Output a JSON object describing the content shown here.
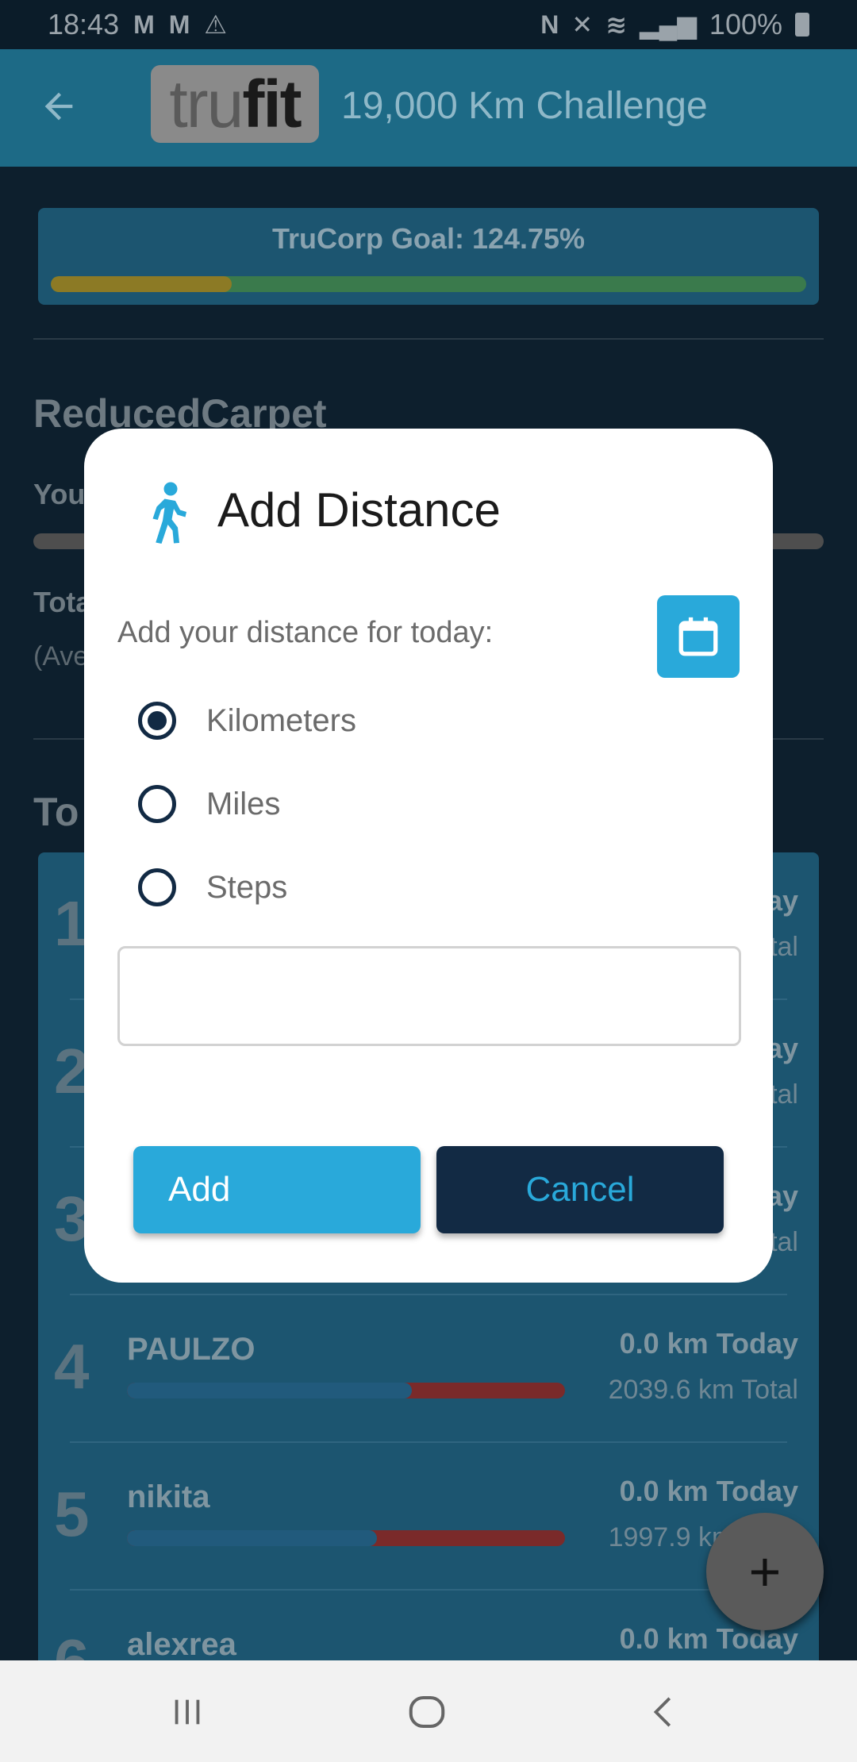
{
  "status_bar": {
    "time": "18:43",
    "notif_icons": [
      "M",
      "M",
      "⚠"
    ],
    "battery": "100%"
  },
  "app_bar": {
    "logo_light": "tru",
    "logo_dark": "fit",
    "title": "19,000 Km Challenge"
  },
  "goal": {
    "label": "TruCorp Goal: 124.75%",
    "progress": 0.24
  },
  "team": {
    "name": "ReducedCarpet",
    "you_label": "You",
    "total_label": "Tota",
    "average_label": "(Ave"
  },
  "leaderboard": {
    "title": "To",
    "rows": [
      {
        "rank": "1",
        "name": "",
        "today": "ay",
        "total": "tal",
        "progress": 0.0
      },
      {
        "rank": "2",
        "name": "",
        "today": "ay",
        "total": "tal",
        "progress": 0.0
      },
      {
        "rank": "3",
        "name": "",
        "today": "ay",
        "total": "tal",
        "progress": 0.0
      },
      {
        "rank": "4",
        "name": "PAULZO",
        "today": "0.0 km Today",
        "total": "2039.6 km Total",
        "progress": 0.65
      },
      {
        "rank": "5",
        "name": "nikita",
        "today": "0.0 km Today",
        "total": "1997.9 km Total",
        "progress": 0.57
      },
      {
        "rank": "6",
        "name": "alexrea",
        "today": "0.0 km Today",
        "total": "",
        "progress": 0.0
      }
    ]
  },
  "fab": {
    "label": "+"
  },
  "dialog": {
    "title": "Add Distance",
    "prompt": "Add your distance for today:",
    "options": [
      {
        "label": "Kilometers",
        "selected": true
      },
      {
        "label": "Miles",
        "selected": false
      },
      {
        "label": "Steps",
        "selected": false
      }
    ],
    "input_value": "",
    "add_label": "Add",
    "cancel_label": "Cancel"
  },
  "colors": {
    "accent": "#29a9da",
    "navy": "#122a44",
    "app_bar": "#1d6a86"
  },
  "icons": {
    "back": "arrow-left-icon",
    "walk": "walking-person-icon",
    "calendar": "calendar-icon",
    "nav_recents": "recents-icon",
    "nav_home": "home-icon",
    "nav_back": "back-chevron-icon"
  }
}
